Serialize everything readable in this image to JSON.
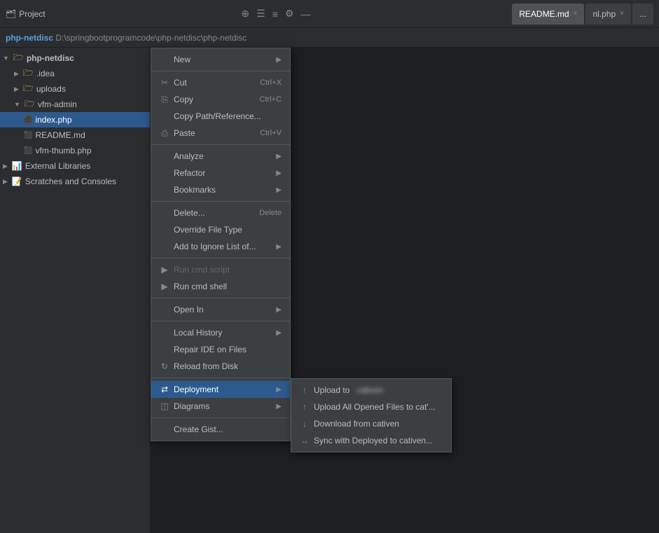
{
  "topbar": {
    "project_label": "Project",
    "tabs": [
      {
        "label": "README.md",
        "active": true,
        "close": "×"
      },
      {
        "label": "nl.php",
        "active": false,
        "close": "×"
      },
      {
        "label": "...",
        "active": false,
        "close": null
      }
    ],
    "icons": [
      "⊕",
      "☰",
      "≡",
      "⚙",
      "—"
    ]
  },
  "pathbar": {
    "project_name": "php-netdisc",
    "path": "D:\\springbootprogramcode\\php-netdisc\\php-netdisc"
  },
  "sidebar": {
    "tree": [
      {
        "label": "php-netdisc",
        "level": 0,
        "type": "folder",
        "expanded": true,
        "bold": true
      },
      {
        "label": ".idea",
        "level": 1,
        "type": "folder",
        "expanded": false
      },
      {
        "label": "uploads",
        "level": 1,
        "type": "folder",
        "expanded": false
      },
      {
        "label": "vfm-admin",
        "level": 1,
        "type": "folder",
        "expanded": true
      },
      {
        "label": "index.php",
        "level": 2,
        "type": "php",
        "selected": true
      },
      {
        "label": "README.md",
        "level": 2,
        "type": "md"
      },
      {
        "label": "vfm-thumb.php",
        "level": 2,
        "type": "php"
      },
      {
        "label": "External Libraries",
        "level": 0,
        "type": "section"
      },
      {
        "label": "Scratches and Consoles",
        "level": 0,
        "type": "section"
      }
    ]
  },
  "context_menu": {
    "items": [
      {
        "label": "New",
        "type": "submenu",
        "icon": "",
        "shortcut": ""
      },
      {
        "type": "divider"
      },
      {
        "label": "Cut",
        "type": "item",
        "icon": "✂",
        "shortcut": "Ctrl+X"
      },
      {
        "label": "Copy",
        "type": "item",
        "icon": "⎘",
        "shortcut": "Ctrl+C"
      },
      {
        "label": "Copy Path/Reference...",
        "type": "item",
        "icon": "",
        "shortcut": ""
      },
      {
        "label": "Paste",
        "type": "item",
        "icon": "⎙",
        "shortcut": "Ctrl+V"
      },
      {
        "type": "divider"
      },
      {
        "label": "Analyze",
        "type": "submenu",
        "icon": "",
        "shortcut": ""
      },
      {
        "label": "Refactor",
        "type": "submenu",
        "icon": "",
        "shortcut": ""
      },
      {
        "label": "Bookmarks",
        "type": "submenu",
        "icon": "",
        "shortcut": ""
      },
      {
        "type": "divider"
      },
      {
        "label": "Delete...",
        "type": "item",
        "icon": "",
        "shortcut": "Delete"
      },
      {
        "label": "Override File Type",
        "type": "item",
        "icon": "",
        "shortcut": ""
      },
      {
        "label": "Add to Ignore List of...",
        "type": "submenu",
        "icon": "",
        "shortcut": ""
      },
      {
        "type": "divider"
      },
      {
        "label": "Run cmd script",
        "type": "item",
        "icon": "▶",
        "shortcut": "",
        "disabled": true
      },
      {
        "label": "Run cmd shell",
        "type": "item",
        "icon": "▶",
        "shortcut": ""
      },
      {
        "type": "divider"
      },
      {
        "label": "Open In",
        "type": "submenu",
        "icon": "",
        "shortcut": ""
      },
      {
        "type": "divider"
      },
      {
        "label": "Local History",
        "type": "submenu",
        "icon": "",
        "shortcut": ""
      },
      {
        "label": "Repair IDE on Files",
        "type": "item",
        "icon": "",
        "shortcut": ""
      },
      {
        "label": "Reload from Disk",
        "type": "item",
        "icon": "↻",
        "shortcut": ""
      },
      {
        "type": "divider"
      },
      {
        "label": "Deployment",
        "type": "submenu",
        "icon": "⇄",
        "highlighted": true
      },
      {
        "label": "Diagrams",
        "type": "submenu",
        "icon": "◫",
        "shortcut": ""
      },
      {
        "type": "divider"
      },
      {
        "label": "Create Gist...",
        "type": "item",
        "icon": "",
        "shortcut": ""
      }
    ]
  },
  "deployment_submenu": {
    "items": [
      {
        "label": "Upload to",
        "blurred_suffix": "cativen",
        "icon": "↑"
      },
      {
        "label": "Upload All Opened Files to cat'...",
        "icon": "↑"
      },
      {
        "label": "Download from cativen",
        "icon": "↓"
      },
      {
        "label": "Sync with Deployed to cativen...",
        "icon": "↔"
      }
    ]
  }
}
